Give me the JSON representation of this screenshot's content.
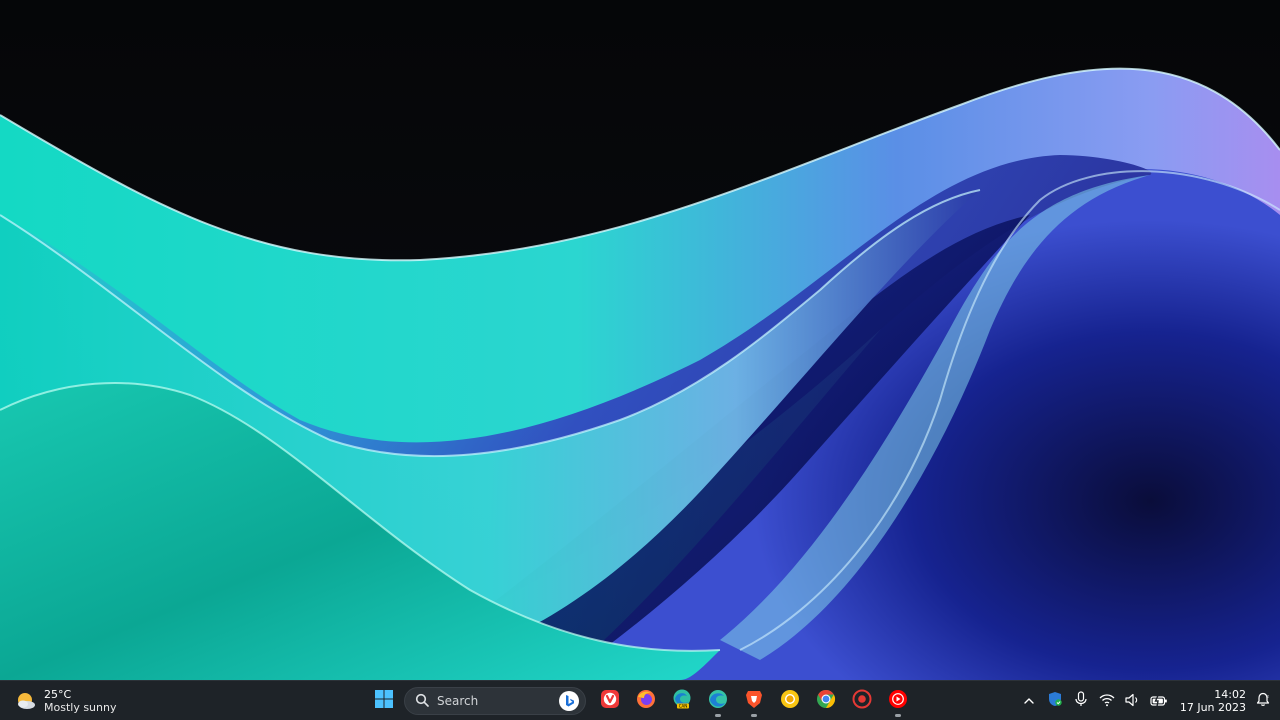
{
  "weather": {
    "temperature": "25°C",
    "condition": "Mostly sunny"
  },
  "search": {
    "label": "Search"
  },
  "taskbar_apps": [
    {
      "icon": "windows-start-icon"
    },
    {
      "icon": "vivaldi-icon"
    },
    {
      "icon": "firefox-icon"
    },
    {
      "icon": "edge-canary-icon"
    },
    {
      "icon": "edge-icon"
    },
    {
      "icon": "brave-icon"
    },
    {
      "icon": "chrome-canary-icon"
    },
    {
      "icon": "chrome-icon"
    },
    {
      "icon": "screen-recorder-icon"
    },
    {
      "icon": "youtube-music-icon"
    }
  ],
  "tray": {
    "icons": [
      "chevron-up-icon",
      "defender-icon",
      "microphone-icon",
      "wifi-icon",
      "volume-icon",
      "battery-icon"
    ],
    "time": "14:02",
    "date": "17 Jun 2023"
  },
  "colors": {
    "taskbar": "#1e2328",
    "accent": "#2fd4c6",
    "wallpaper_dark": "#07080b"
  }
}
